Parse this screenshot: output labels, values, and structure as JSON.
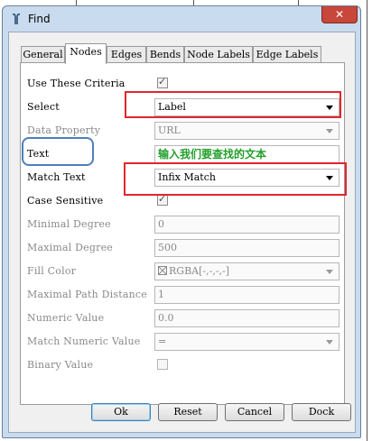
{
  "window": {
    "title": "Find",
    "close_glyph": "✕"
  },
  "tabs": [
    "General",
    "Nodes",
    "Edges",
    "Bends",
    "Node Labels",
    "Edge Labels"
  ],
  "active_tab": "Nodes",
  "rows": {
    "use_criteria": {
      "label": "Use These Criteria",
      "checked": true
    },
    "select": {
      "label": "Select",
      "value": "Label"
    },
    "data_property": {
      "label": "Data Property",
      "value": "URL"
    },
    "text": {
      "label": "Text",
      "value": "输入我们要查找的文本"
    },
    "match_text": {
      "label": "Match Text",
      "value": "Infix Match"
    },
    "case_sensitive": {
      "label": "Case Sensitive",
      "checked": true
    },
    "min_degree": {
      "label": "Minimal Degree",
      "value": "0"
    },
    "max_degree": {
      "label": "Maximal Degree",
      "value": "500"
    },
    "fill_color": {
      "label": "Fill Color",
      "value": "RGBA[-,-,-,-]"
    },
    "max_path": {
      "label": "Maximal Path Distance",
      "value": "1"
    },
    "numeric": {
      "label": "Numeric Value",
      "value": "0.0"
    },
    "match_numeric": {
      "label": "Match Numeric Value",
      "value": "="
    },
    "binary": {
      "label": "Binary Value",
      "checked": false
    }
  },
  "buttons": {
    "ok": "Ok",
    "reset": "Reset",
    "cancel": "Cancel",
    "dock": "Dock"
  },
  "colors": {
    "highlight_red": "#e0262e",
    "highlight_blue": "#4f7fb8",
    "text_green": "#22a02a"
  },
  "check_glyph": "✓"
}
